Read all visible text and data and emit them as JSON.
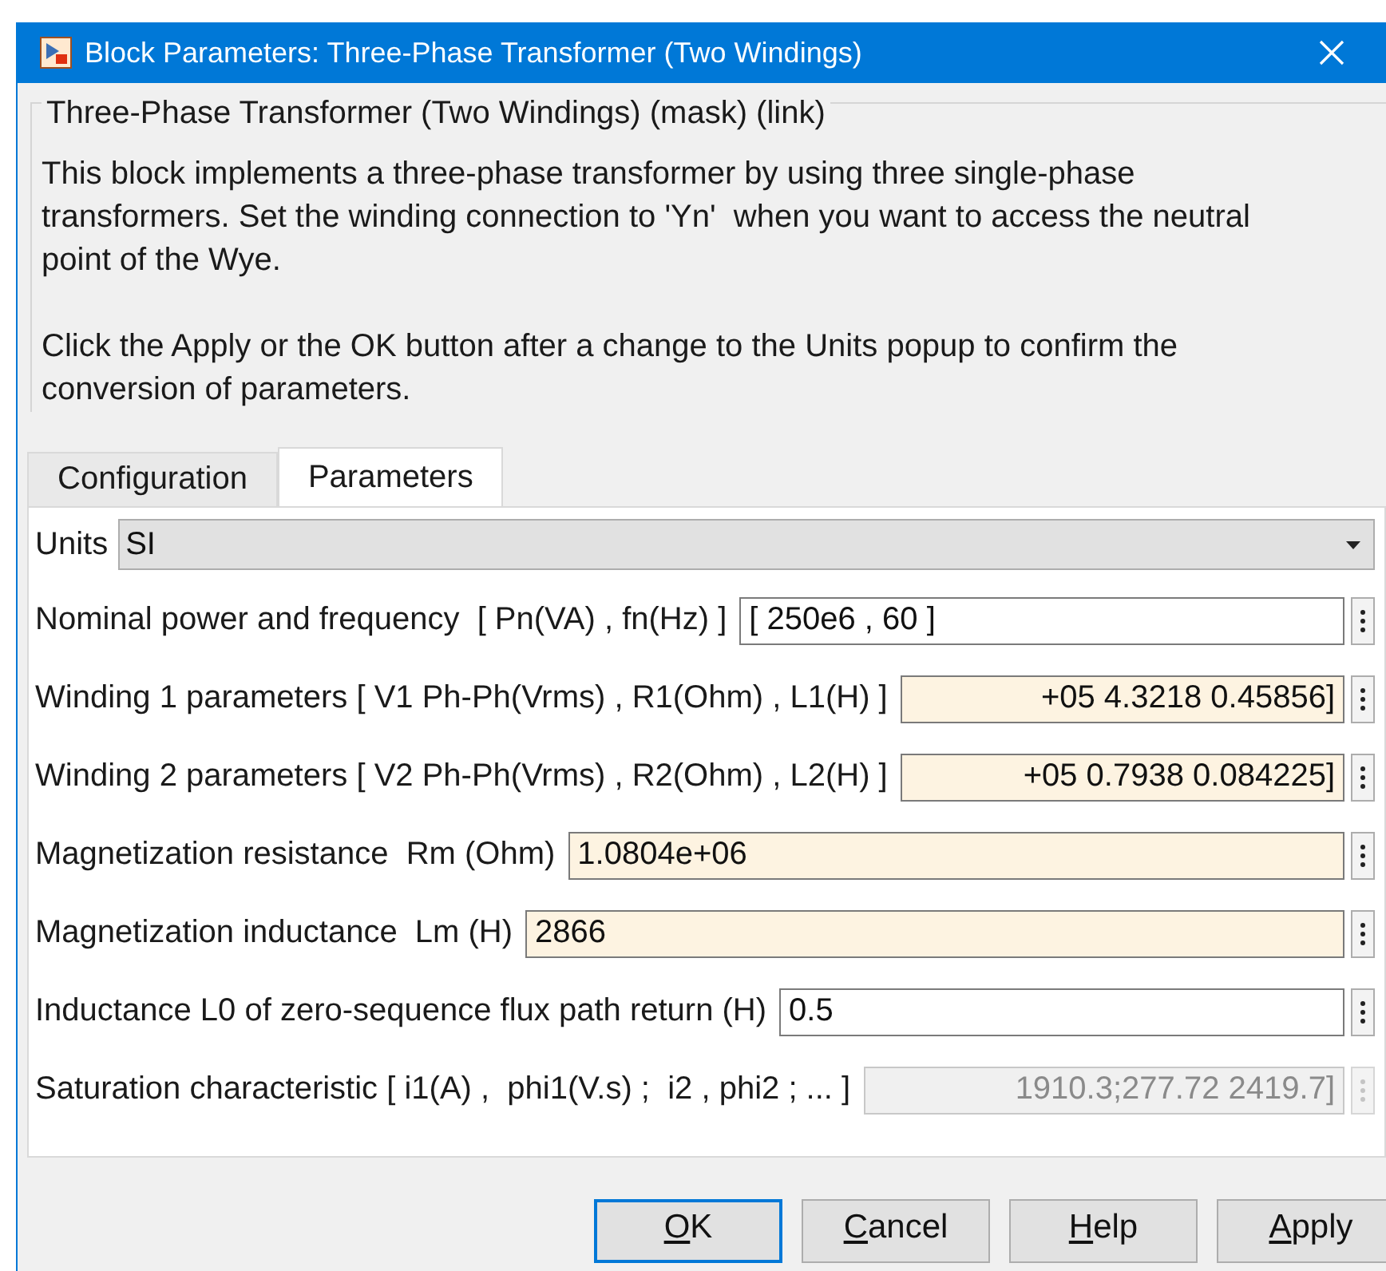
{
  "window": {
    "title": "Block Parameters: Three-Phase Transformer (Two Windings)"
  },
  "group": {
    "title": "Three-Phase Transformer (Two Windings) (mask) (link)",
    "paragraphs": [
      "This block implements a three-phase transformer by using three single-phase transformers. Set the winding connection to 'Yn'  when you want to access the neutral point of the Wye.",
      "Click the Apply or the OK button after a change to the Units popup to confirm the conversion of parameters."
    ]
  },
  "tabs": [
    {
      "label": "Configuration",
      "selected": false
    },
    {
      "label": "Parameters",
      "selected": true
    }
  ],
  "units": {
    "label": "Units",
    "value": "SI"
  },
  "parameters": [
    {
      "label": "Nominal power and frequency  [ Pn(VA) , fn(Hz) ]",
      "value": "[ 250e6 , 60 ]",
      "kind": "plain",
      "scrolled": false
    },
    {
      "label": "Winding 1 parameters [ V1 Ph-Ph(Vrms) , R1(Ohm) , L1(H) ]",
      "value": "+05 4.3218 0.45856]",
      "kind": "modified",
      "scrolled": true
    },
    {
      "label": "Winding 2 parameters [ V2 Ph-Ph(Vrms) , R2(Ohm) , L2(H) ]",
      "value": "+05 0.7938 0.084225]",
      "kind": "modified",
      "scrolled": true
    },
    {
      "label": "Magnetization resistance  Rm (Ohm)",
      "value": "1.0804e+06",
      "kind": "modified",
      "scrolled": false
    },
    {
      "label": "Magnetization inductance  Lm (H)",
      "value": "2866",
      "kind": "modified",
      "scrolled": false
    },
    {
      "label": "Inductance L0 of zero-sequence flux path return (H)",
      "value": "0.5",
      "kind": "plain",
      "scrolled": false
    },
    {
      "label": "Saturation characteristic [ i1(A) ,  phi1(V.s) ;  i2 , phi2 ; ... ]",
      "value": "1910.3;277.72 2419.7]",
      "kind": "disabled",
      "scrolled": true
    }
  ],
  "buttons": [
    {
      "label": "OK",
      "default": true
    },
    {
      "label": "Cancel",
      "default": false
    },
    {
      "label": "Help",
      "default": false
    },
    {
      "label": "Apply",
      "default": false
    }
  ]
}
